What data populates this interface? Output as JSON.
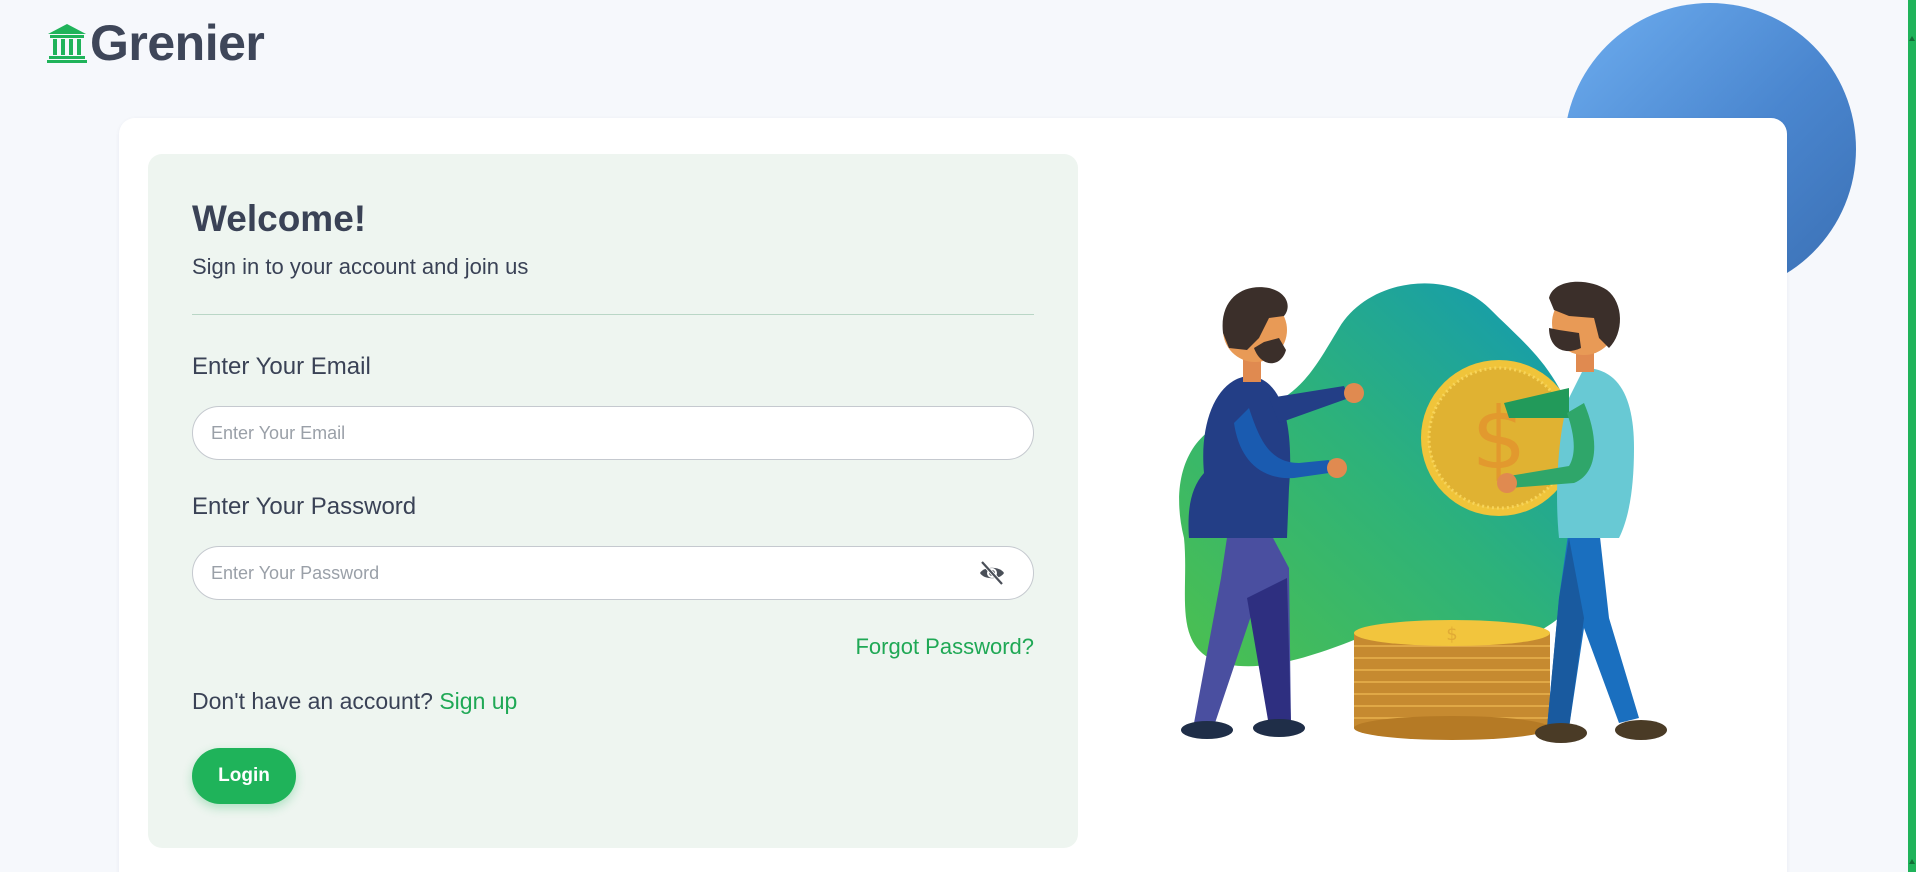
{
  "brand": {
    "name": "Grenier",
    "logo_icon": "bank-icon",
    "color": "#1fb35a"
  },
  "form": {
    "title": "Welcome!",
    "subtitle": "Sign in to your account and join us",
    "email_label": "Enter Your Email",
    "email_placeholder": "Enter Your Email",
    "email_value": "",
    "password_label": "Enter Your Password",
    "password_placeholder": "Enter Your Password",
    "password_value": "",
    "password_toggle_icon": "eye-slash-icon",
    "forgot_password": "Forgot Password?",
    "signup_prompt": "Don't have an account?",
    "signup_link": "Sign up",
    "login_button": "Login"
  },
  "colors": {
    "accent": "#1fb35a",
    "panel_bg": "#eef5f0",
    "text": "#3a4256",
    "circle": "#4a86cf"
  },
  "illustration": {
    "icon": "money-exchange-illustration",
    "coin_symbol": "$"
  }
}
